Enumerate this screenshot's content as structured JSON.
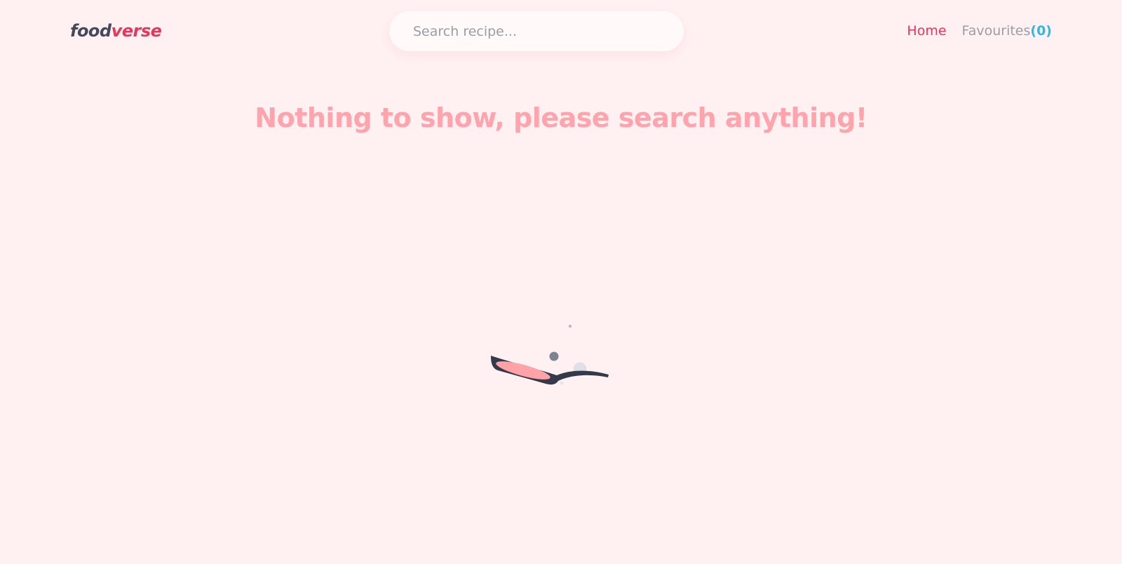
{
  "navbar": {
    "logo": {
      "part1": "food",
      "part2": "verse"
    },
    "search": {
      "placeholder": "Search recipe...",
      "value": ""
    },
    "links": {
      "home": "Home",
      "favourites_label": "Favourites",
      "favourites_count": "(0)"
    }
  },
  "main": {
    "empty_message": "Nothing to show, please search anything!",
    "loader_icon": "frying-pan-icon"
  },
  "colors": {
    "background": "#fff0f1",
    "accent": "#e5375d",
    "heading": "#ffa3ac",
    "count": "#2fb8e6",
    "logo_dark": "#434a5e"
  }
}
